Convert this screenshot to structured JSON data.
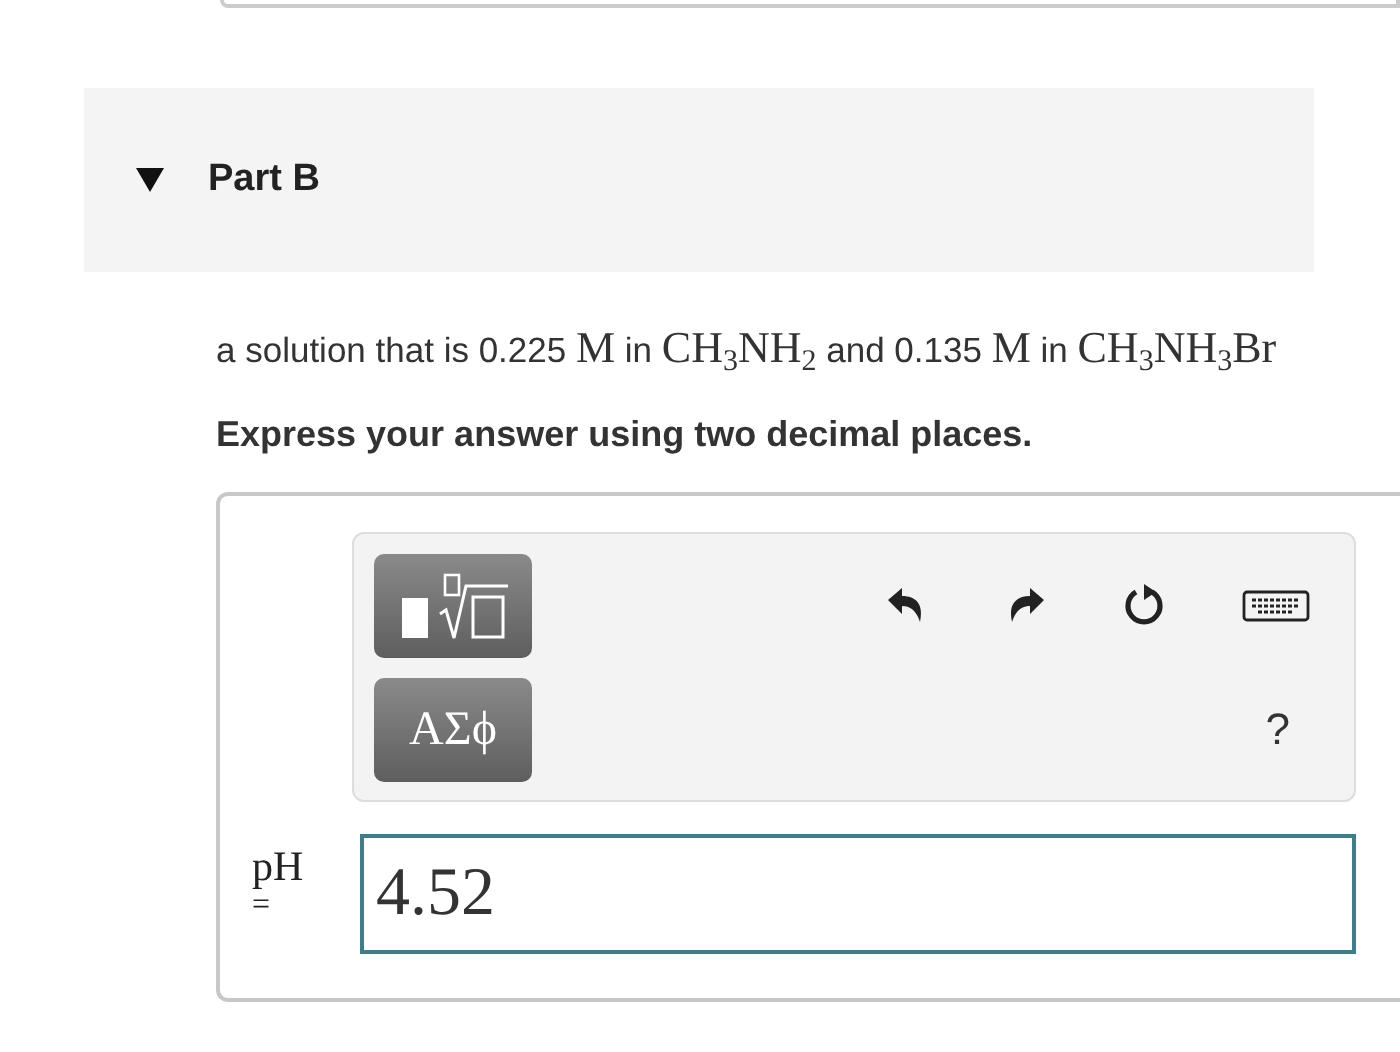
{
  "part": {
    "title": "Part B",
    "expanded": true
  },
  "question": [
    {
      "kind": "text",
      "text": "a solution that is 0.225 "
    },
    {
      "kind": "math",
      "text": "M"
    },
    {
      "kind": "text",
      "text": " in "
    },
    {
      "kind": "math",
      "text": "CH$_{3}$NH$_{2}$"
    },
    {
      "kind": "text",
      "text": " and 0.135 "
    },
    {
      "kind": "math",
      "text": "M"
    },
    {
      "kind": "text",
      "text": " in "
    },
    {
      "kind": "math",
      "text": "CH$_{3}$NH$_{3}$Br"
    }
  ],
  "instruction": "Express your answer using two decimal places.",
  "toolbar": {
    "symbols_button": "ΑΣϕ",
    "help": "?"
  },
  "answer": {
    "label": "pH",
    "equals": "=",
    "value": "4.52"
  }
}
